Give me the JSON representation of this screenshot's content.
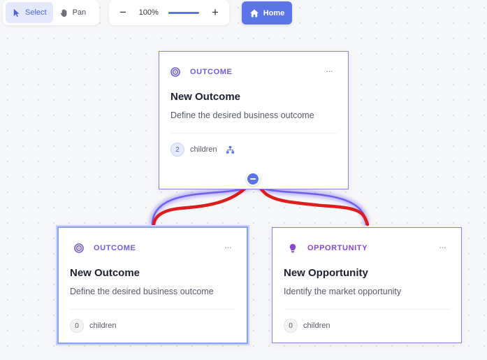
{
  "toolbar": {
    "select_label": "Select",
    "pan_label": "Pan",
    "zoom_out": "−",
    "zoom_level": "100%",
    "zoom_in": "+",
    "home_label": "Home"
  },
  "nodes": [
    {
      "type_label": "OUTCOME",
      "icon": "target-icon",
      "title": "New Outcome",
      "description": "Define the desired business outcome",
      "children_count": "2",
      "children_label": "children",
      "more": "···"
    },
    {
      "type_label": "OUTCOME",
      "icon": "target-icon",
      "title": "New Outcome",
      "description": "Define the desired business outcome",
      "children_count": "0",
      "children_label": "children",
      "more": "···"
    },
    {
      "type_label": "OPPORTUNITY",
      "icon": "lightbulb-icon",
      "title": "New Opportunity",
      "description": "Identify the market opportunity",
      "children_count": "0",
      "children_label": "children",
      "more": "···"
    }
  ],
  "colors": {
    "accent": "#5b74e8",
    "outcome": "#6c5fd6",
    "opportunity": "#8b46d6",
    "edge_glow": "#7c68f0",
    "annotation": "#dd1c1c"
  }
}
